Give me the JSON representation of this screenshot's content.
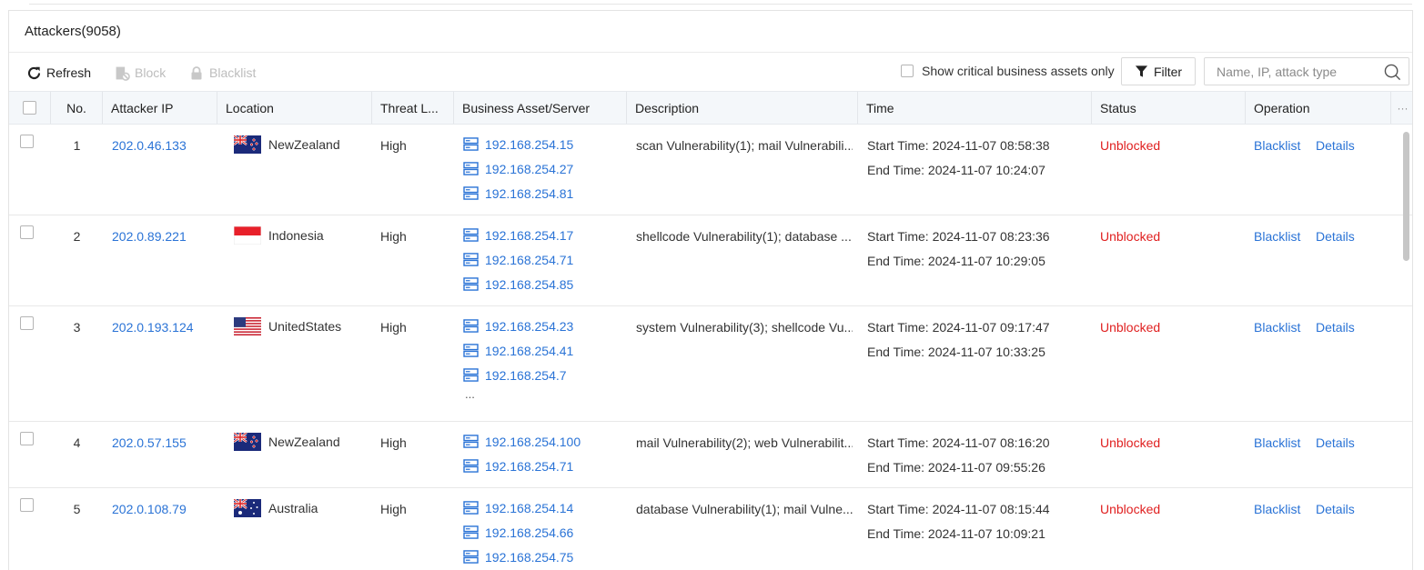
{
  "panel": {
    "title": "Attackers(9058)"
  },
  "toolbar": {
    "refresh_label": "Refresh",
    "block_label": "Block",
    "blacklist_label": "Blacklist",
    "critical_label": "Show critical business assets only",
    "critical_checked": false,
    "filter_label": "Filter",
    "search_placeholder": "Name, IP, attack type"
  },
  "table": {
    "columns": {
      "no": "No.",
      "ip": "Attacker IP",
      "location": "Location",
      "threat": "Threat L...",
      "asset": "Business Asset/Server",
      "description": "Description",
      "time": "Time",
      "status": "Status",
      "operation": "Operation",
      "more": "···"
    },
    "rows": [
      {
        "no": "1",
        "ip": "202.0.46.133",
        "location": "NewZealand",
        "flag": "nz",
        "threat": "High",
        "assets": [
          "192.168.254.15",
          "192.168.254.27",
          "192.168.254.81"
        ],
        "more_assets": "",
        "description": "scan Vulnerability(1); mail Vulnerabili...",
        "start": "Start Time: 2024-11-07 08:58:38",
        "end": "End Time: 2024-11-07 10:24:07",
        "status": "Unblocked",
        "op_blacklist": "Blacklist",
        "op_details": "Details"
      },
      {
        "no": "2",
        "ip": "202.0.89.221",
        "location": "Indonesia",
        "flag": "id",
        "threat": "High",
        "assets": [
          "192.168.254.17",
          "192.168.254.71",
          "192.168.254.85"
        ],
        "more_assets": "",
        "description": "shellcode Vulnerability(1); database ...",
        "start": "Start Time: 2024-11-07 08:23:36",
        "end": "End Time: 2024-11-07 10:29:05",
        "status": "Unblocked",
        "op_blacklist": "Blacklist",
        "op_details": "Details"
      },
      {
        "no": "3",
        "ip": "202.0.193.124",
        "location": "UnitedStates",
        "flag": "us",
        "threat": "High",
        "assets": [
          "192.168.254.23",
          "192.168.254.41",
          "192.168.254.7"
        ],
        "more_assets": "...",
        "description": "system Vulnerability(3); shellcode Vu...",
        "start": "Start Time: 2024-11-07 09:17:47",
        "end": "End Time: 2024-11-07 10:33:25",
        "status": "Unblocked",
        "op_blacklist": "Blacklist",
        "op_details": "Details"
      },
      {
        "no": "4",
        "ip": "202.0.57.155",
        "location": "NewZealand",
        "flag": "nz",
        "threat": "High",
        "assets": [
          "192.168.254.100",
          "192.168.254.71"
        ],
        "more_assets": "",
        "description": "mail Vulnerability(2); web Vulnerabilit...",
        "start": "Start Time: 2024-11-07 08:16:20",
        "end": "End Time: 2024-11-07 09:55:26",
        "status": "Unblocked",
        "op_blacklist": "Blacklist",
        "op_details": "Details"
      },
      {
        "no": "5",
        "ip": "202.0.108.79",
        "location": "Australia",
        "flag": "au",
        "threat": "High",
        "assets": [
          "192.168.254.14",
          "192.168.254.66",
          "192.168.254.75"
        ],
        "more_assets": "",
        "description": "database Vulnerability(1); mail Vulne...",
        "start": "Start Time: 2024-11-07 08:15:44",
        "end": "End Time: 2024-11-07 10:09:21",
        "status": "Unblocked",
        "op_blacklist": "Blacklist",
        "op_details": "Details"
      }
    ]
  },
  "colors": {
    "link": "#2a73d6",
    "status_unblocked": "#e02020",
    "header_bg": "#f4f7fa"
  }
}
